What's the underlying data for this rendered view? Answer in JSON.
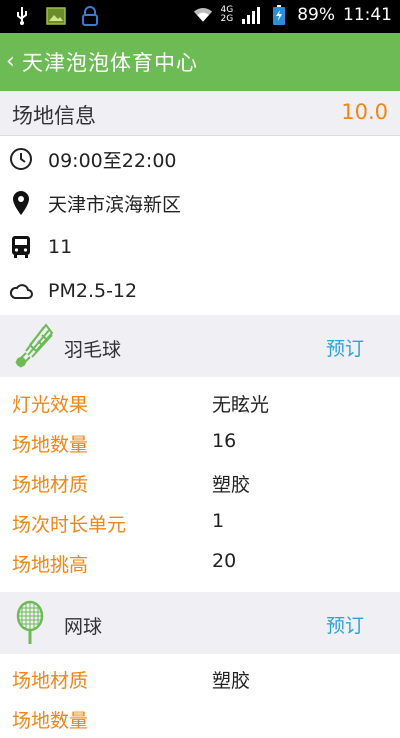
{
  "status_bar": {
    "network_top": "4G",
    "network_bottom": "2G",
    "battery": "89%",
    "time": "11:41",
    "icons": [
      "usb-icon",
      "image-icon",
      "lock-icon",
      "wifi-icon",
      "signal-icon",
      "battery-icon"
    ]
  },
  "titlebar": {
    "back_glyph": "‹",
    "title": "天津泡泡体育中心",
    "color": "#6dbb55"
  },
  "info": {
    "heading": "场地信息",
    "score": "10.0",
    "hours": "09:00至22:00",
    "location": "天津市滨海新区",
    "bus": "11",
    "air": "PM2.5-12"
  },
  "sports": [
    {
      "name": "羽毛球",
      "book": "预订",
      "icon": "shuttlecock-icon",
      "details": [
        {
          "k": "灯光效果",
          "v": "无眩光"
        },
        {
          "k": "场地数量",
          "v": "16"
        },
        {
          "k": "场地材质",
          "v": "塑胶"
        },
        {
          "k": "场次时长单元",
          "v": "1"
        },
        {
          "k": "场地挑高",
          "v": "20"
        }
      ]
    },
    {
      "name": "网球",
      "book": "预订",
      "icon": "tennis-racket-icon",
      "details": [
        {
          "k": "场地材质",
          "v": "塑胶"
        },
        {
          "k": "场地数量",
          "v": ""
        }
      ]
    }
  ],
  "colors": {
    "accent_orange": "#f08519",
    "link_blue": "#2aa3d8",
    "section_bg": "#f0eff4"
  }
}
